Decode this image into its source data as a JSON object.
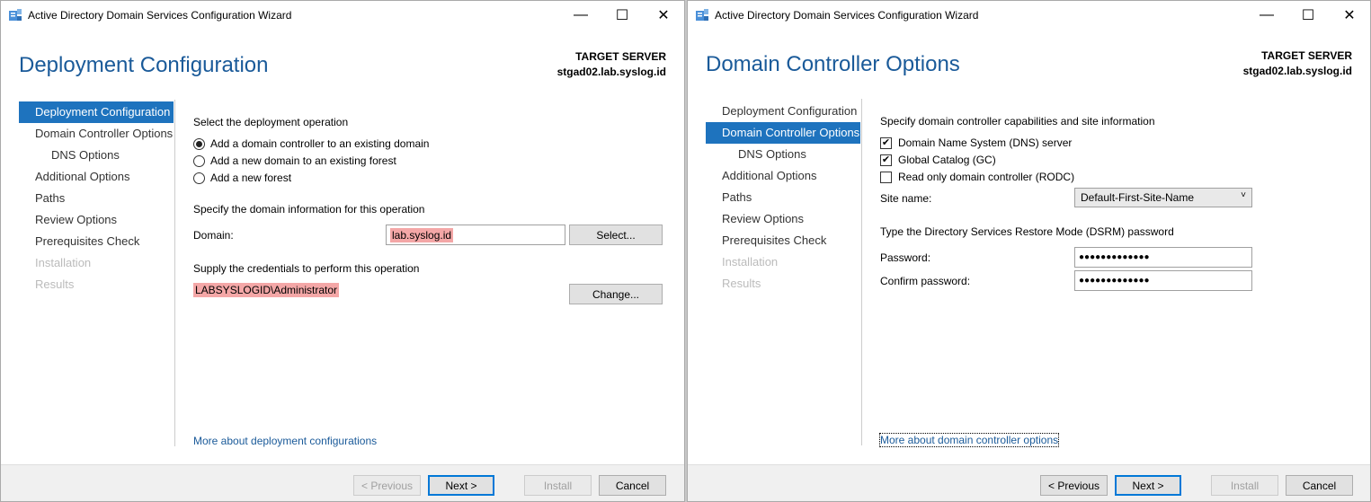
{
  "win1": {
    "title": "Active Directory Domain Services Configuration Wizard",
    "page_title": "Deployment Configuration",
    "target_label": "TARGET SERVER",
    "target_server": "stgad02.lab.syslog.id",
    "nav": [
      {
        "label": "Deployment Configuration"
      },
      {
        "label": "Domain Controller Options"
      },
      {
        "label": "DNS Options"
      },
      {
        "label": "Additional Options"
      },
      {
        "label": "Paths"
      },
      {
        "label": "Review Options"
      },
      {
        "label": "Prerequisites Check"
      },
      {
        "label": "Installation"
      },
      {
        "label": "Results"
      }
    ],
    "select_operation_label": "Select the deployment operation",
    "radios": [
      {
        "label": "Add a domain controller to an existing domain",
        "selected": true
      },
      {
        "label": "Add a new domain to an existing forest",
        "selected": false
      },
      {
        "label": "Add a new forest",
        "selected": false
      }
    ],
    "domain_info_label": "Specify the domain information for this operation",
    "domain_label": "Domain:",
    "domain_value": "lab.syslog.id",
    "select_button": "Select...",
    "credentials_label": "Supply the credentials to perform this operation",
    "credentials_value": "LABSYSLOGID\\Administrator",
    "change_button": "Change...",
    "more_link": "More about deployment configurations",
    "buttons": {
      "previous": "< Previous",
      "next": "Next >",
      "install": "Install",
      "cancel": "Cancel"
    }
  },
  "win2": {
    "title": "Active Directory Domain Services Configuration Wizard",
    "page_title": "Domain Controller Options",
    "target_label": "TARGET SERVER",
    "target_server": "stgad02.lab.syslog.id",
    "nav": [
      {
        "label": "Deployment Configuration"
      },
      {
        "label": "Domain Controller Options"
      },
      {
        "label": "DNS Options"
      },
      {
        "label": "Additional Options"
      },
      {
        "label": "Paths"
      },
      {
        "label": "Review Options"
      },
      {
        "label": "Prerequisites Check"
      },
      {
        "label": "Installation"
      },
      {
        "label": "Results"
      }
    ],
    "capabilities_label": "Specify domain controller capabilities and site information",
    "checks": [
      {
        "label": "Domain Name System (DNS) server",
        "checked": true
      },
      {
        "label": "Global Catalog (GC)",
        "checked": true
      },
      {
        "label": "Read only domain controller (RODC)",
        "checked": false
      }
    ],
    "site_name_label": "Site name:",
    "site_name_value": "Default-First-Site-Name",
    "dsrm_label": "Type the Directory Services Restore Mode (DSRM) password",
    "password_label": "Password:",
    "password_value": "●●●●●●●●●●●●●",
    "confirm_label": "Confirm password:",
    "confirm_value": "●●●●●●●●●●●●●",
    "more_link": "More about domain controller options",
    "buttons": {
      "previous": "< Previous",
      "next": "Next >",
      "install": "Install",
      "cancel": "Cancel"
    }
  },
  "window_controls": {
    "minimize": "—",
    "maximize": "☐",
    "close": "✕"
  }
}
